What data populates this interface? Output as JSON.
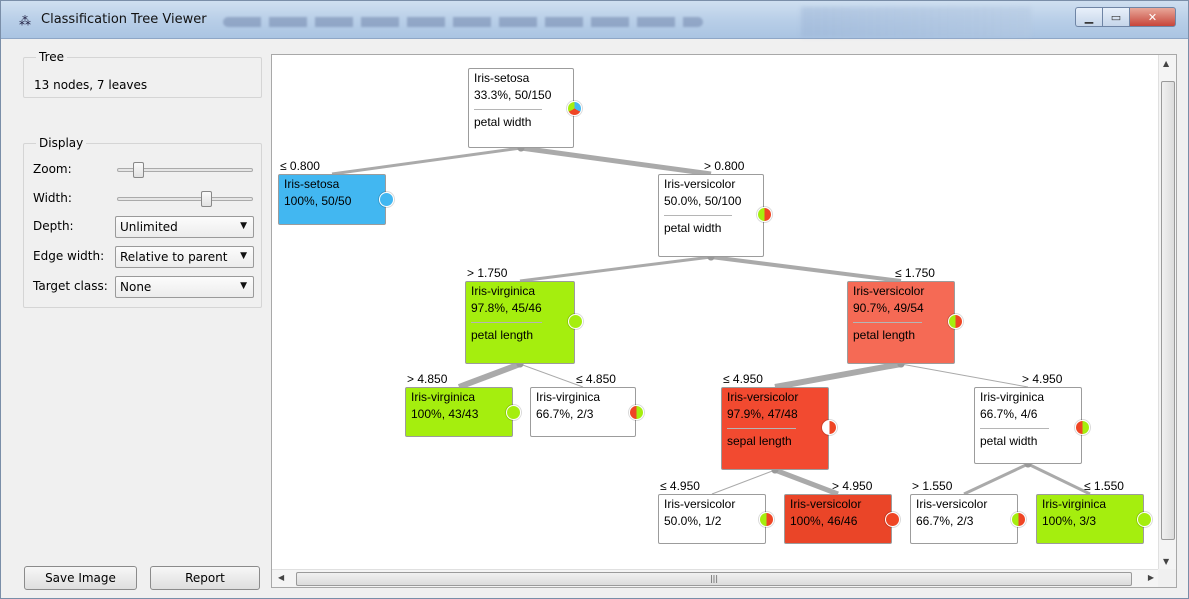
{
  "window": {
    "title": "Classification Tree Viewer",
    "app_icon": "tree-icon",
    "buttons": {
      "minimize": "▁",
      "maximize": "▭",
      "close": "✕"
    }
  },
  "tree_group": {
    "title": "Tree",
    "info": "13 nodes, 7 leaves"
  },
  "display_group": {
    "title": "Display",
    "zoom_label": "Zoom:",
    "zoom_value": 0.15,
    "width_label": "Width:",
    "width_value": 0.65,
    "depth_label": "Depth:",
    "depth_value": "Unlimited",
    "edge_width_label": "Edge width:",
    "edge_width_value": "Relative to parent",
    "target_class_label": "Target class:",
    "target_class_value": "None"
  },
  "buttons": {
    "save_image": "Save Image",
    "report": "Report"
  },
  "colors": {
    "setosa": "#42b7f1",
    "versicolor": "#ef4524",
    "virginica": "#a5ee0e",
    "edge": "#aaaaaa"
  },
  "tree": {
    "nodes": [
      {
        "id": "n0",
        "cls": "Iris-setosa",
        "stat": "33.3%, 50/150",
        "split": "petal width",
        "fill": "#ffffff"
      },
      {
        "id": "n1",
        "cls": "Iris-setosa",
        "stat": "100%, 50/50",
        "split": "",
        "fill": "#42b7f1"
      },
      {
        "id": "n2",
        "cls": "Iris-versicolor",
        "stat": "50.0%, 50/100",
        "split": "petal width",
        "fill": "#ffffff"
      },
      {
        "id": "n3",
        "cls": "Iris-virginica",
        "stat": "97.8%, 45/46",
        "split": "petal length",
        "fill": "#a5ee0e"
      },
      {
        "id": "n4",
        "cls": "Iris-versicolor",
        "stat": "90.7%, 49/54",
        "split": "petal length",
        "fill": "#f56a55"
      },
      {
        "id": "n5",
        "cls": "Iris-virginica",
        "stat": "100%, 43/43",
        "split": "",
        "fill": "#a5ee0e"
      },
      {
        "id": "n6",
        "cls": "Iris-virginica",
        "stat": "66.7%, 2/3",
        "split": "",
        "fill": "#ffffff"
      },
      {
        "id": "n7",
        "cls": "Iris-versicolor",
        "stat": "97.9%, 47/48",
        "split": "sepal length",
        "fill": "#f24a30"
      },
      {
        "id": "n8",
        "cls": "Iris-virginica",
        "stat": "66.7%, 4/6",
        "split": "petal width",
        "fill": "#ffffff"
      },
      {
        "id": "n9",
        "cls": "Iris-versicolor",
        "stat": "50.0%, 1/2",
        "split": "",
        "fill": "#ffffff"
      },
      {
        "id": "n10",
        "cls": "Iris-versicolor",
        "stat": "100%, 46/46",
        "split": "",
        "fill": "#ea4528"
      },
      {
        "id": "n11",
        "cls": "Iris-versicolor",
        "stat": "66.7%, 2/3",
        "split": "",
        "fill": "#ffffff"
      },
      {
        "id": "n12",
        "cls": "Iris-virginica",
        "stat": "100%, 3/3",
        "split": "",
        "fill": "#a5ee0e"
      }
    ],
    "edges": [
      {
        "from": "n0",
        "to": "n1",
        "label": "≤ 0.800"
      },
      {
        "from": "n0",
        "to": "n2",
        "label": "> 0.800"
      },
      {
        "from": "n2",
        "to": "n3",
        "label": "> 1.750"
      },
      {
        "from": "n2",
        "to": "n4",
        "label": "≤ 1.750"
      },
      {
        "from": "n3",
        "to": "n5",
        "label": "> 4.850"
      },
      {
        "from": "n3",
        "to": "n6",
        "label": "≤ 4.850"
      },
      {
        "from": "n4",
        "to": "n7",
        "label": "≤ 4.950"
      },
      {
        "from": "n4",
        "to": "n8",
        "label": "> 4.950"
      },
      {
        "from": "n7",
        "to": "n9",
        "label": "≤ 4.950"
      },
      {
        "from": "n7",
        "to": "n10",
        "label": "> 4.950"
      },
      {
        "from": "n8",
        "to": "n11",
        "label": "> 1.550"
      },
      {
        "from": "n8",
        "to": "n12",
        "label": "≤ 1.550"
      }
    ]
  }
}
